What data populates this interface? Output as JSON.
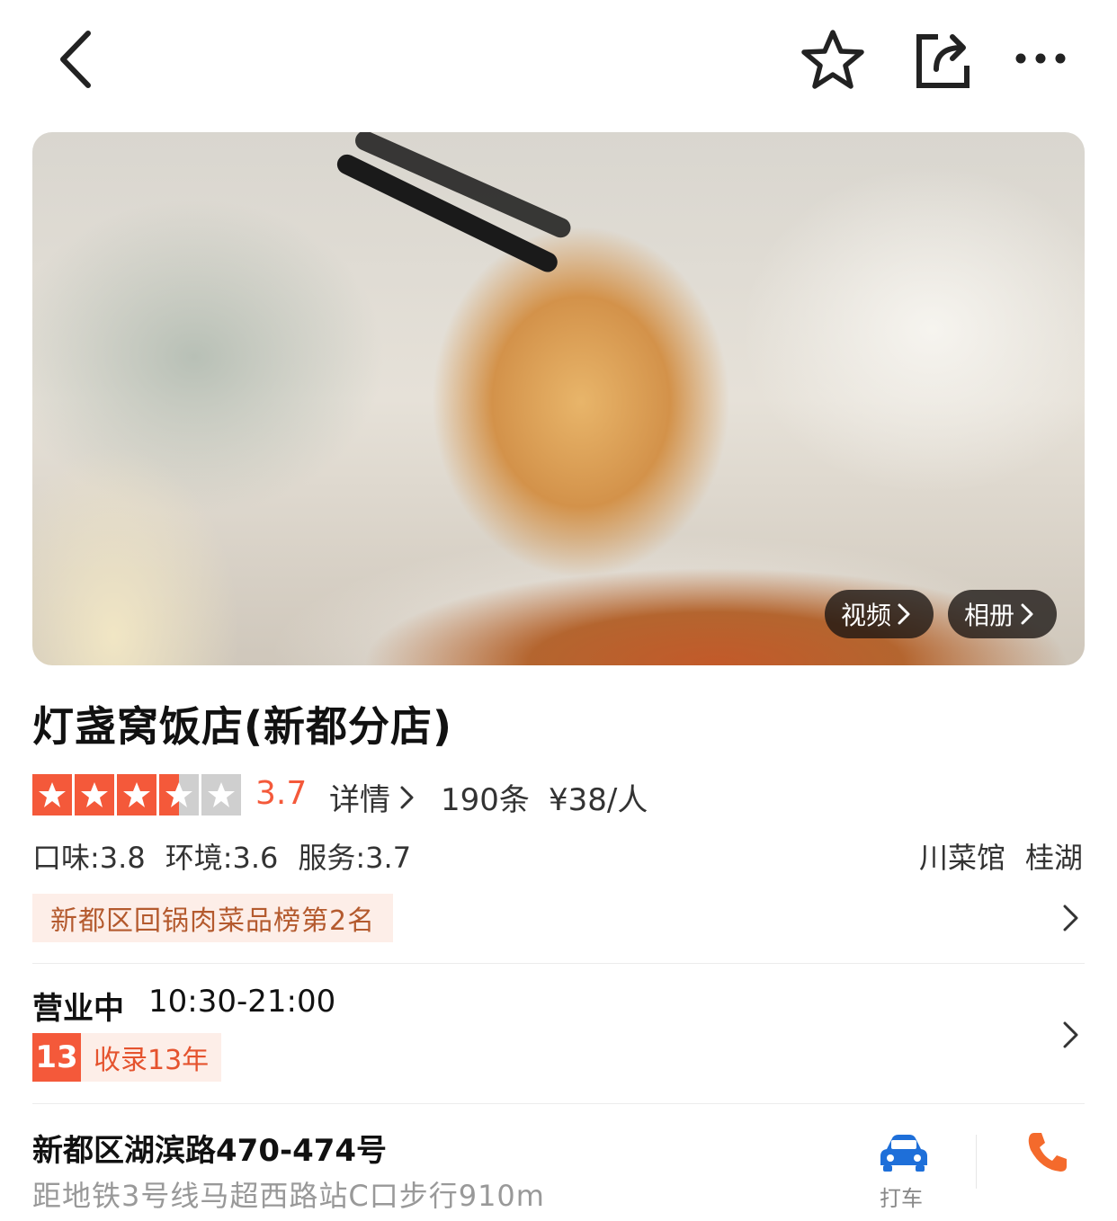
{
  "topbar": {
    "back_icon": "chevron-left-icon",
    "favorite_icon": "star-outline-icon",
    "share_icon": "share-icon",
    "more_icon": "more-horizontal-icon"
  },
  "hero": {
    "video_label": "视频",
    "album_label": "相册"
  },
  "restaurant": {
    "name": "灯盏窝饭店(新都分店)",
    "rating": "3.7",
    "rating_value": 3.7,
    "detail_label": "详情",
    "review_count": "190条",
    "price_per_person": "¥38/人",
    "scores": {
      "taste": "口味:3.8",
      "environment": "环境:3.6",
      "service": "服务:3.7"
    },
    "category": "川菜馆",
    "area": "桂湖",
    "ranking": "新都区回锅肉菜品榜第2名"
  },
  "hours": {
    "status": "营业中",
    "time": "10:30-21:00",
    "years_badge": "13",
    "years_text": "收录13年"
  },
  "address": {
    "street": "新都区湖滨路470-474号",
    "metro": "距地铁3号线马超西路站C口步行910m",
    "taxi_label": "打车",
    "taxi_icon": "car-icon",
    "phone_icon": "phone-icon"
  },
  "colors": {
    "accent": "#f4593a",
    "rank_bg": "#fdeee8",
    "rank_text": "#b45a2e",
    "taxi_blue": "#1e6fd9",
    "phone_orange": "#f46a2c"
  }
}
